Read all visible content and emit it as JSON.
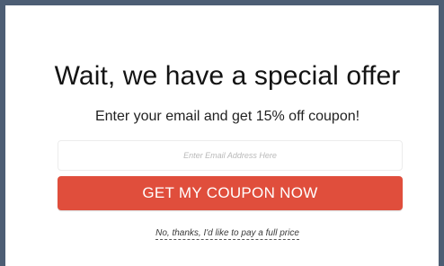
{
  "popup": {
    "title": "Wait, we have a special offer",
    "subtitle": "Enter your email and get 15% off coupon!",
    "email_placeholder": "Enter Email Address Here",
    "cta_label": "GET MY COUPON NOW",
    "decline_label": "No, thanks, I'd like to pay a full price"
  },
  "colors": {
    "border": "#4d5e74",
    "cta_background": "#e04e3c",
    "cta_text": "#ffffff",
    "title_text": "#141414"
  }
}
